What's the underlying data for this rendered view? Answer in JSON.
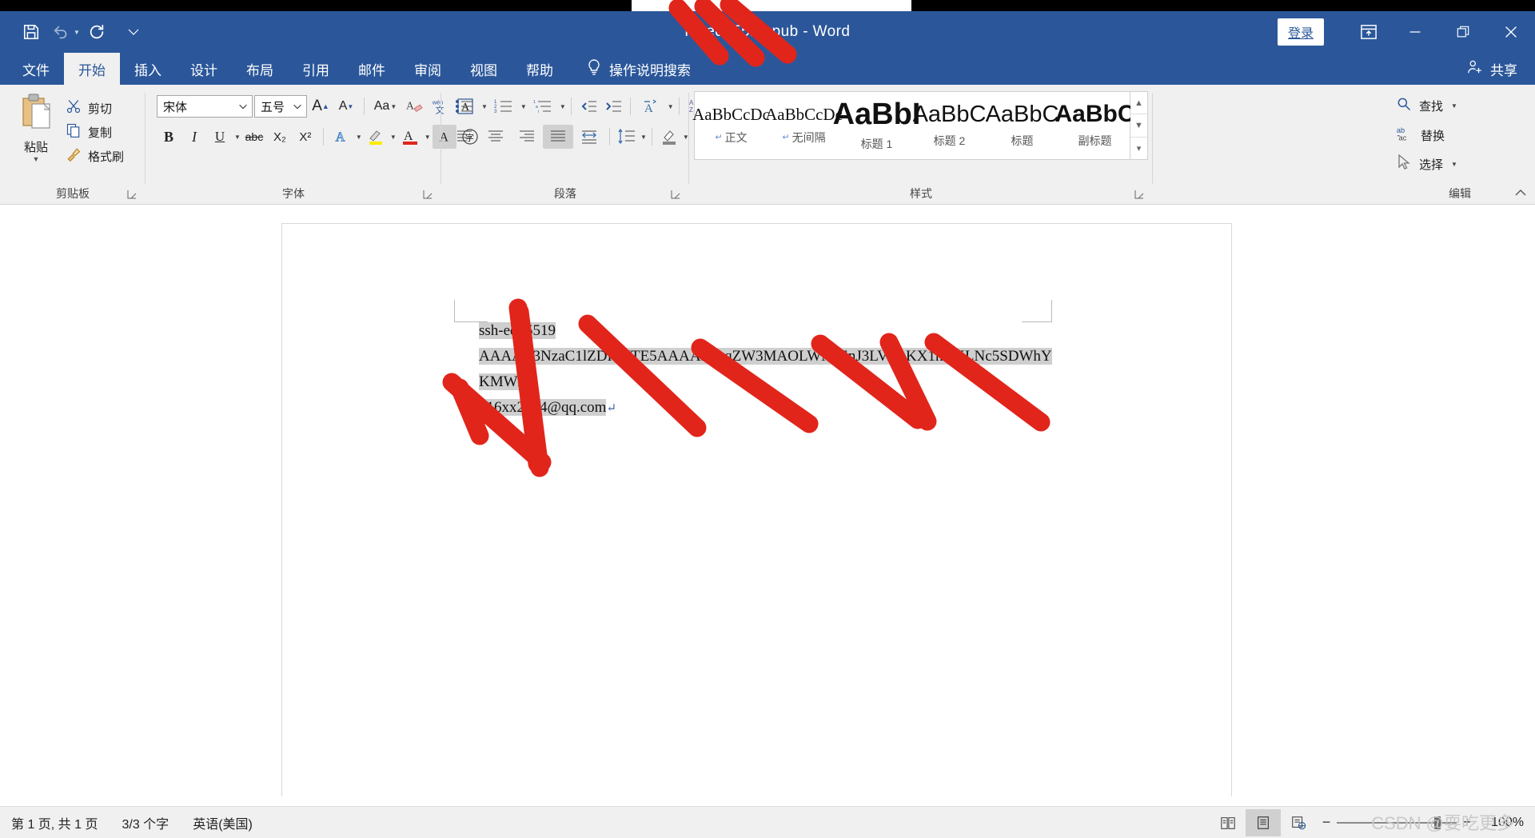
{
  "window": {
    "title": "id_ed25519.pub  -  Word",
    "signin_label": "登录",
    "ribbon_display_icon": "ribbon-display-options-icon",
    "minimize_icon": "minimize-icon",
    "maximize_icon": "restore-icon",
    "close_icon": "close-icon"
  },
  "quick_access": {
    "save_icon": "save-icon",
    "undo_icon": "undo-icon",
    "redo_icon": "redo-icon",
    "customize_icon": "customize-quick-access-icon"
  },
  "tabs": [
    {
      "label": "文件",
      "active": false
    },
    {
      "label": "开始",
      "active": true
    },
    {
      "label": "插入",
      "active": false
    },
    {
      "label": "设计",
      "active": false
    },
    {
      "label": "布局",
      "active": false
    },
    {
      "label": "引用",
      "active": false
    },
    {
      "label": "邮件",
      "active": false
    },
    {
      "label": "审阅",
      "active": false
    },
    {
      "label": "视图",
      "active": false
    },
    {
      "label": "帮助",
      "active": false
    }
  ],
  "tell_me": {
    "label": "操作说明搜索",
    "icon": "lightbulb-icon"
  },
  "share": {
    "label": "共享",
    "icon": "share-person-icon"
  },
  "ribbon": {
    "clipboard": {
      "group_label": "剪贴板",
      "paste_label": "粘贴",
      "items": [
        {
          "label": "剪切",
          "icon": "scissors-icon"
        },
        {
          "label": "复制",
          "icon": "copy-icon"
        },
        {
          "label": "格式刷",
          "icon": "format-painter-icon"
        }
      ]
    },
    "font": {
      "group_label": "字体",
      "font_name": "宋体",
      "font_size": "五号",
      "grow_font": "A",
      "shrink_font": "A",
      "change_case": "Aa",
      "bold": "B",
      "italic": "I",
      "underline": "U",
      "strikethrough": "abc",
      "subscript": "X₂",
      "superscript": "X²",
      "text_effects_icon": "text-effects-icon",
      "highlight_icon": "text-highlight-icon",
      "font_color_icon": "font-color-icon",
      "clear_format_icon": "clear-formatting-icon",
      "phonetic_guide_icon": "phonetic-guide-icon",
      "char_border_icon": "character-border-icon",
      "char_shading_icon": "character-shading-icon",
      "enclose_char_icon": "enclose-character-icon"
    },
    "paragraph": {
      "group_label": "段落",
      "bullets_icon": "bullet-list-icon",
      "numbering_icon": "numbered-list-icon",
      "multilevel_icon": "multilevel-list-icon",
      "decrease_indent_icon": "decrease-indent-icon",
      "increase_indent_icon": "increase-indent-icon",
      "asian_layout_icon": "asian-layout-icon",
      "sort_icon": "sort-icon",
      "show_marks_icon": "show-formatting-marks-icon",
      "align_left_icon": "align-left-icon",
      "align_center_icon": "align-center-icon",
      "align_right_icon": "align-right-icon",
      "justify_icon": "justify-icon",
      "distribute_icon": "distributed-align-icon",
      "line_spacing_icon": "line-spacing-icon",
      "shading_icon": "shading-icon",
      "borders_icon": "borders-icon"
    },
    "styles": {
      "group_label": "样式",
      "items": [
        {
          "preview": "AaBbCcDc",
          "name": "正文",
          "size": 21,
          "weight": "normal",
          "pilcrow": true
        },
        {
          "preview": "AaBbCcDc",
          "name": "无间隔",
          "size": 21,
          "weight": "normal",
          "pilcrow": true
        },
        {
          "preview": "AaBbI",
          "name": "标题 1",
          "size": 38,
          "weight": "bold",
          "pilcrow": false
        },
        {
          "preview": "AaBbC",
          "name": "标题 2",
          "size": 29,
          "weight": "normal",
          "pilcrow": false
        },
        {
          "preview": "AaBbC",
          "name": "标题",
          "size": 29,
          "weight": "normal",
          "pilcrow": false
        },
        {
          "preview": "AaBbC",
          "name": "副标题",
          "size": 30,
          "weight": "bold",
          "pilcrow": false
        }
      ],
      "scroll_up_icon": "scroll-up-icon",
      "scroll_down_icon": "scroll-down-icon",
      "more_styles_icon": "more-styles-icon"
    },
    "editing": {
      "group_label": "编辑",
      "items": [
        {
          "label": "查找",
          "icon": "search-icon",
          "has_caret": true
        },
        {
          "label": "替换",
          "icon": "replace-icon",
          "has_caret": false
        },
        {
          "label": "选择",
          "icon": "select-pointer-icon",
          "has_caret": true
        }
      ]
    },
    "collapse_icon": "collapse-ribbon-icon"
  },
  "document": {
    "line1": "ssh-ed25519",
    "line2": "AAAAC3NzaC1lZDI1NTE5AAAAIAxqZW3MAOLWMtEnJ3LV/JoKX1hXXLNc5SDWhYKMWXh",
    "line3": "916xx28x4@qq.com",
    "paragraph_mark": "↵"
  },
  "statusbar": {
    "page_info": "第 1 页, 共 1 页",
    "word_count": "3/3 个字",
    "language": "英语(美国)",
    "view_read_icon": "read-mode-icon",
    "view_print_icon": "print-layout-icon",
    "view_web_icon": "web-layout-icon",
    "zoom_out": "−",
    "zoom_in": "+",
    "zoom_level": "100%",
    "watermark": "CSDN @耍吃更多"
  },
  "colors": {
    "accent": "#2b579a",
    "ribbon_bg": "#f0f0f0",
    "scribble": "#e1251b",
    "selection": "#cfcfcf"
  }
}
